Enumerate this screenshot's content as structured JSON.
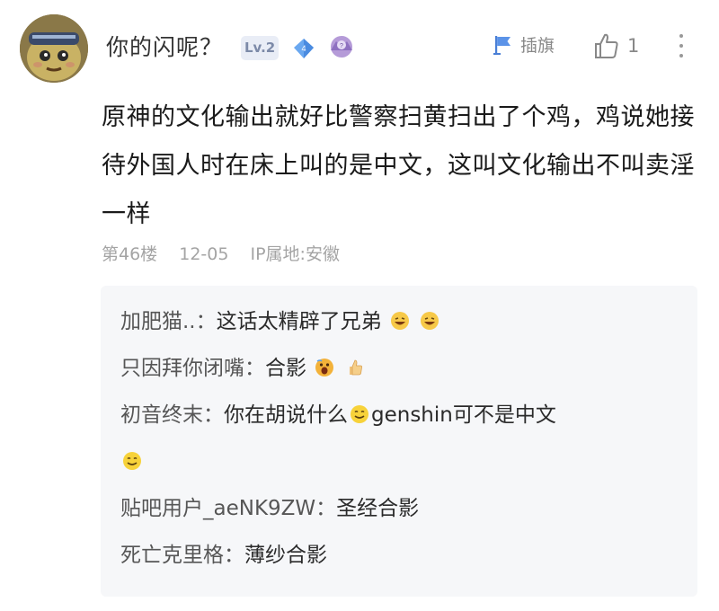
{
  "post": {
    "username": "你的闪呢？",
    "level": "Lv.2",
    "gem_count": "4",
    "actions": {
      "flag_label": "插旗",
      "like_count": "1"
    },
    "content": "原神的文化输出就好比警察扫黄扫出了个鸡，鸡说她接待外国人时在床上叫的是中文，这叫文化输出不叫卖淫一样",
    "meta": {
      "floor": "第46楼",
      "date": "12-05",
      "ip": "IP属地:安徽"
    }
  },
  "replies": [
    {
      "name": "加肥猫..：",
      "text": "这话太精辟了兄弟",
      "emojis_after": [
        "grin-emoji",
        "grin-emoji"
      ]
    },
    {
      "name": "只因拜你闭嘴：",
      "text": "合影",
      "emojis_after": [
        "scared-emoji",
        "thumbs-up-emoji"
      ]
    },
    {
      "name": "初音终末：",
      "text_before": "你在胡说什么",
      "text_after": "genshin可不是中文",
      "emojis_mid": [
        "smile-emoji"
      ],
      "emojis_after": [
        "smile-emoji"
      ]
    },
    {
      "name": "贴吧用户_aeNK9ZW：",
      "text": "圣经合影"
    },
    {
      "name": "死亡克里格：",
      "text": "薄纱合影"
    }
  ],
  "colors": {
    "reply_bg": "#f6f7f9",
    "meta_text": "#a4a4a4",
    "level_bg": "#e9edf6"
  }
}
